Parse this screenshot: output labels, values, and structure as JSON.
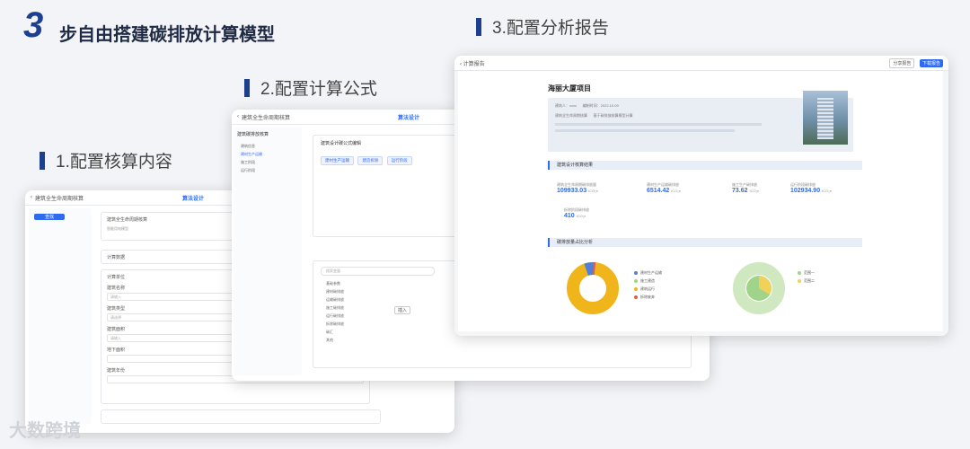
{
  "hero": {
    "number": "3",
    "title": "步自由搭建碳排放计算模型"
  },
  "steps": [
    {
      "label": "1.配置核算内容"
    },
    {
      "label": "2.配置计算公式"
    },
    {
      "label": "3.配置分析报告"
    }
  ],
  "watermark": "大数跨境",
  "card1": {
    "title": "建筑全生命周期核算",
    "tab": "算法设计",
    "search_btn": "查找",
    "list_title": "建筑全生命周期核算",
    "list_sub": "智能用电模型",
    "section_a": "计算数据",
    "section_b": "计算单位",
    "fields": [
      "建筑名称",
      "建筑类型",
      "建筑面积",
      "地下面积",
      "建筑年份"
    ],
    "placeholders": [
      "请输入",
      "请选择",
      "请输入"
    ]
  },
  "card2": {
    "title": "建筑全生命周期核算",
    "tab": "算法设计",
    "panel_title": "建筑碳排放核算",
    "formula_title": "建筑设计碳公式编辑",
    "chips": [
      "建材生产运输",
      "建造拆除",
      "运行阶段"
    ],
    "tree_top": [
      "建筑信息",
      "建材生产运输",
      "施工阶段",
      "运行阶段"
    ],
    "search_placeholder": "搜索变量",
    "var_items": [
      "基础参数",
      "建材碳排放",
      "运输碳排放",
      "施工碳排放",
      "运行碳排放",
      "拆除碳排放",
      "碳汇",
      "其他"
    ],
    "bottom_btn": "插入"
  },
  "card3": {
    "back_label": "计算报告",
    "btn_secondary": "分享报告",
    "btn_primary": "下载报告",
    "project_title": "海丽大厦项目",
    "info_lines": [
      "建筑人：xxxx",
      "编制时间：2022.10.09",
      "建筑全生命周期核算",
      "基于碳排放核算模型计算"
    ],
    "section_result": "建筑设计核算结果",
    "section_analysis": "碳排放量占比分析",
    "metrics": [
      {
        "label": "建筑全生命周期碳排放量",
        "value": "109933.03",
        "unit": "tCO₂e"
      },
      {
        "label": "建材生产运输碳排放",
        "value": "6514.42",
        "unit": "tCO₂e"
      },
      {
        "label": "施工生产碳排放",
        "value": "73.62",
        "unit": "tCO₂e"
      },
      {
        "label": "运行阶段碳排放",
        "value": "102934.90",
        "unit": "tCO₂e"
      },
      {
        "label": "拆除阶段碳排放",
        "value": "410",
        "unit": "tCO₂e"
      }
    ],
    "legend_left": [
      "建材生产运输",
      "施工建造",
      "建筑运行",
      "拆除废弃"
    ],
    "legend_right": [
      "范围一",
      "范围二"
    ]
  },
  "colors": {
    "accent": "#2f6bf2",
    "brand": "#1d3f8f",
    "pie_yellow": "#f0b51b",
    "pie_green": "#9fd48a",
    "pie_blue": "#4f7fd9",
    "pie_red": "#e05a4f"
  }
}
